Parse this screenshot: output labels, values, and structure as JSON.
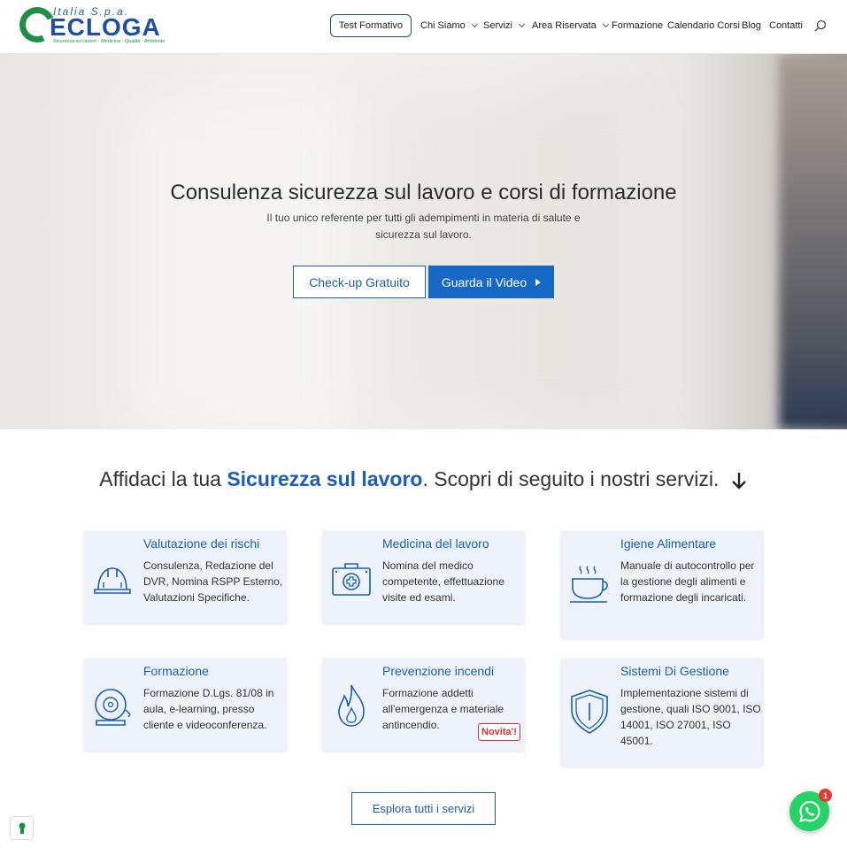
{
  "logo": {
    "italia": "Italia S.p.a.",
    "name": "ECLOGA",
    "tagline": "Sicurezza sul lavoro - Medicina - Qualità - Ambiente"
  },
  "nav": {
    "test_formativo": "Test Formativo",
    "items": [
      {
        "label": "Chi Siamo",
        "dropdown": true
      },
      {
        "label": "Servizi",
        "dropdown": true
      },
      {
        "label": "Area Riservata",
        "dropdown": true
      },
      {
        "label": "Formazione",
        "dropdown": false
      },
      {
        "label": "Calendario Corsi",
        "dropdown": false
      },
      {
        "label": "Blog",
        "dropdown": false
      },
      {
        "label": "Contatti",
        "dropdown": false
      }
    ],
    "search_icon": "search-icon"
  },
  "hero": {
    "title": "Consulenza sicurezza sul lavoro e corsi di formazione",
    "subtitle": "Il tuo unico referente per tutti gli adempimenti in materia di salute e sicurezza sul lavoro.",
    "btn_checkup": "Check-up Gratuito",
    "btn_video": "Guarda il Video"
  },
  "services": {
    "title_pre": "Affidaci la tua ",
    "title_highlight": "Sicurezza sul lavoro",
    "title_post": ". Scopri di seguito i nostri servizi.",
    "cards": [
      {
        "title": "Valutazione dei rischi",
        "text": "Consulenza, Redazione del DVR, Nomina RSPP Esterno, Valutazioni Specifiche.",
        "icon": "helmet-icon"
      },
      {
        "title": "Medicina del lavoro",
        "text": "Nomina del medico competente, effettuazione visite ed esami.",
        "icon": "medical-kit-icon"
      },
      {
        "title": "Igiene Alimentare",
        "text": "Manuale di autocontrollo per la gestione degli alimenti e formazione degli incaricati.",
        "icon": "coffee-cup-icon"
      },
      {
        "title": "Formazione",
        "text": "Formazione D.Lgs. 81/08 in aula, e-learning, presso cliente e videoconferenza.",
        "icon": "alarm-bell-icon"
      },
      {
        "title": "Prevenzione incendi",
        "text": "Formazione addetti all'emergenza e materiale antincendio.",
        "icon": "flame-icon"
      },
      {
        "title": "Sistemi Di Gestione",
        "text": "Implementazione sistemi di gestione, quali ISO 9001, ISO 14001, ISO 27001, ISO 45001.",
        "icon": "shield-icon"
      }
    ],
    "new_badge": "Novita'!",
    "explore_button": "Esplora tutti i servizi"
  },
  "widgets": {
    "whatsapp_count": "1"
  },
  "colors": {
    "brand_blue": "#1a5fb4",
    "brand_green": "#1f8f47",
    "card_bg": "#eef3fb",
    "whatsapp": "#25d366"
  }
}
